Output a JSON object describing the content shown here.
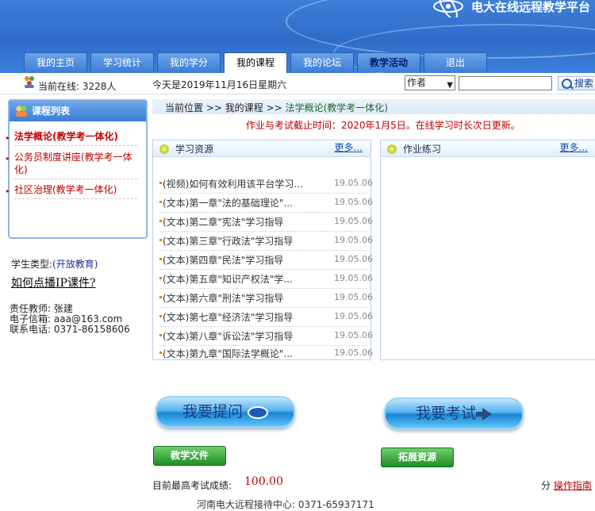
{
  "header": {
    "site_title": "电大在线远程教学平台",
    "tabs": [
      {
        "label": "我的主页",
        "active": false
      },
      {
        "label": "学习统计",
        "active": false
      },
      {
        "label": "我的学分",
        "active": false
      },
      {
        "label": "我的课程",
        "active": true
      },
      {
        "label": "我的论坛",
        "active": false
      },
      {
        "label": "教学活动",
        "active": false
      },
      {
        "label": "退出",
        "active": false
      }
    ]
  },
  "infobar": {
    "online": "当前在线: 3228人",
    "date": "今天是2019年11月16日星期六",
    "search_field": "作者",
    "search_value": "",
    "search_button": "搜索"
  },
  "course_list": {
    "title": "课程列表",
    "items": [
      "法学概论(教学考一体化)",
      "公务员制度讲座(教学考一体化)",
      "社区治理(教学考一体化)"
    ]
  },
  "student": {
    "type_label": "学生类型:",
    "type_value": "(开放教育)",
    "ip_link": "如何点播IP课件?",
    "teacher": "责任教师: 张建",
    "email": "电子信箱: aaa@163.com",
    "phone": "联系电话: 0371-86158606"
  },
  "breadcrumb": {
    "home": "当前位置",
    "sep": ">>",
    "mid": "我的课程",
    "current": "法学概论(教学考一体化)"
  },
  "deadline": "作业与考试截止时间：2020年1月5日。在线学习时长次日更新。",
  "resources": {
    "title": "学习资源",
    "more": "更多...",
    "items": [
      {
        "text": "(视频)如何有效利用该平台学习...",
        "date": "19.05.06"
      },
      {
        "text": "(文本)第一章\"法的基础理论\"...",
        "date": "19.05.06"
      },
      {
        "text": "(文本)第二章\"宪法\"学习指导",
        "date": "19.05.06"
      },
      {
        "text": "(文本)第三章\"行政法\"学习指导",
        "date": "19.05.06"
      },
      {
        "text": "(文本)第四章\"民法\"学习指导",
        "date": "19.05.06"
      },
      {
        "text": "(文本)第五章\"知识产权法\"学...",
        "date": "19.05.06"
      },
      {
        "text": "(文本)第六章\"刑法\"学习指导",
        "date": "19.05.06"
      },
      {
        "text": "(文本)第七章\"经济法\"学习指导",
        "date": "19.05.06"
      },
      {
        "text": "(文本)第八章\"诉讼法\"学习指导",
        "date": "19.05.06"
      },
      {
        "text": "(文本)第九章\"国际法学概论\"...",
        "date": "19.05.06"
      }
    ]
  },
  "homework": {
    "title": "作业练习",
    "more": "更多..."
  },
  "actions": {
    "ask": "我要提问",
    "exam": "我要考试",
    "teach_doc": "教学文件",
    "ext_res": "拓展资源"
  },
  "score": {
    "label": "目前最高考试成绩:",
    "value": "100.00"
  },
  "guide": {
    "prefix": "分",
    "link": "操作指南"
  },
  "hotline": "河南电大远程接待中心: 0371-65937171"
}
